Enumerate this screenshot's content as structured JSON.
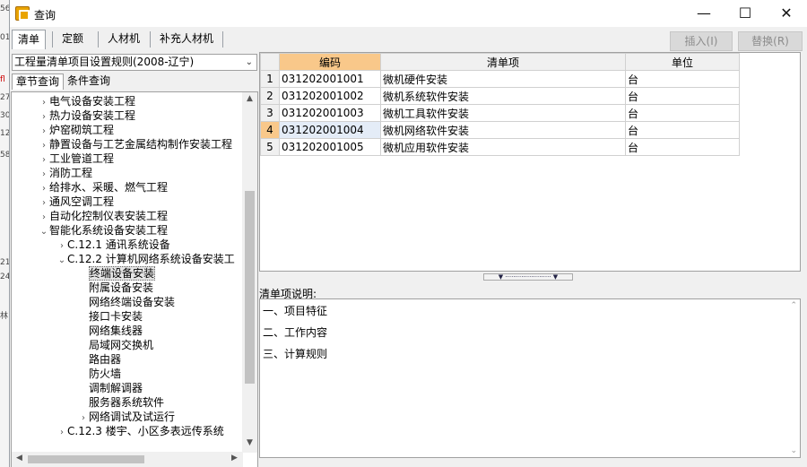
{
  "window": {
    "title": "查询",
    "minimize": "—",
    "maximize": "☐",
    "close": "✕"
  },
  "tabs": [
    "清单",
    "定额",
    "人材机",
    "补充人材机"
  ],
  "toolbar": {
    "insert_label": "插入(I)",
    "replace_label": "替换(R)"
  },
  "left": {
    "rule_combo": "工程量清单项目设置规则(2008-辽宁)",
    "subtabs": [
      "章节查询",
      "条件查询"
    ],
    "tree": [
      {
        "label": "电气设备安装工程",
        "level": 0,
        "expander": "›"
      },
      {
        "label": "热力设备安装工程",
        "level": 0,
        "expander": "›"
      },
      {
        "label": "炉窑砌筑工程",
        "level": 0,
        "expander": "›"
      },
      {
        "label": "静置设备与工艺金属结构制作安装工程",
        "level": 0,
        "expander": "›"
      },
      {
        "label": "工业管道工程",
        "level": 0,
        "expander": "›"
      },
      {
        "label": "消防工程",
        "level": 0,
        "expander": "›"
      },
      {
        "label": "给排水、采暖、燃气工程",
        "level": 0,
        "expander": "›"
      },
      {
        "label": "通风空调工程",
        "level": 0,
        "expander": "›"
      },
      {
        "label": "自动化控制仪表安装工程",
        "level": 0,
        "expander": "›"
      },
      {
        "label": "智能化系统设备安装工程",
        "level": 0,
        "expander": "⌄"
      },
      {
        "label": "C.12.1  通讯系统设备",
        "level": 1,
        "expander": "›"
      },
      {
        "label": "C.12.2  计算机网络系统设备安装工",
        "level": 1,
        "expander": "⌄"
      },
      {
        "label": "终端设备安装",
        "level": 2,
        "expander": "",
        "selected": true
      },
      {
        "label": "附属设备安装",
        "level": 2,
        "expander": ""
      },
      {
        "label": "网络终端设备安装",
        "level": 2,
        "expander": ""
      },
      {
        "label": "接口卡安装",
        "level": 2,
        "expander": ""
      },
      {
        "label": "网络集线器",
        "level": 2,
        "expander": ""
      },
      {
        "label": "局域网交换机",
        "level": 2,
        "expander": ""
      },
      {
        "label": "路由器",
        "level": 2,
        "expander": ""
      },
      {
        "label": "防火墙",
        "level": 2,
        "expander": ""
      },
      {
        "label": "调制解调器",
        "level": 2,
        "expander": ""
      },
      {
        "label": "服务器系统软件",
        "level": 2,
        "expander": ""
      },
      {
        "label": "网络调试及试运行",
        "level": 2,
        "expander": "›"
      },
      {
        "label": "C.12.3  楼宇、小区多表远传系统",
        "level": 1,
        "expander": "›"
      }
    ]
  },
  "grid": {
    "headers": [
      "编码",
      "清单项",
      "单位"
    ],
    "rows": [
      {
        "n": "1",
        "code": "031202001001",
        "name": "微机硬件安装",
        "unit": "台"
      },
      {
        "n": "2",
        "code": "031202001002",
        "name": "微机系统软件安装",
        "unit": "台"
      },
      {
        "n": "3",
        "code": "031202001003",
        "name": "微机工具软件安装",
        "unit": "台"
      },
      {
        "n": "4",
        "code": "031202001004",
        "name": "微机网络软件安装",
        "unit": "台",
        "current": true
      },
      {
        "n": "5",
        "code": "031202001005",
        "name": "微机应用软件安装",
        "unit": "台"
      }
    ]
  },
  "description": {
    "label": "清单项说明:",
    "lines": [
      "一、项目特征",
      "二、工作内容",
      "三、计算规则"
    ]
  },
  "background_fragments": [
    "56",
    "01",
    "fl",
    "27",
    "30",
    "12",
    "58",
    "21",
    "24",
    "林"
  ]
}
